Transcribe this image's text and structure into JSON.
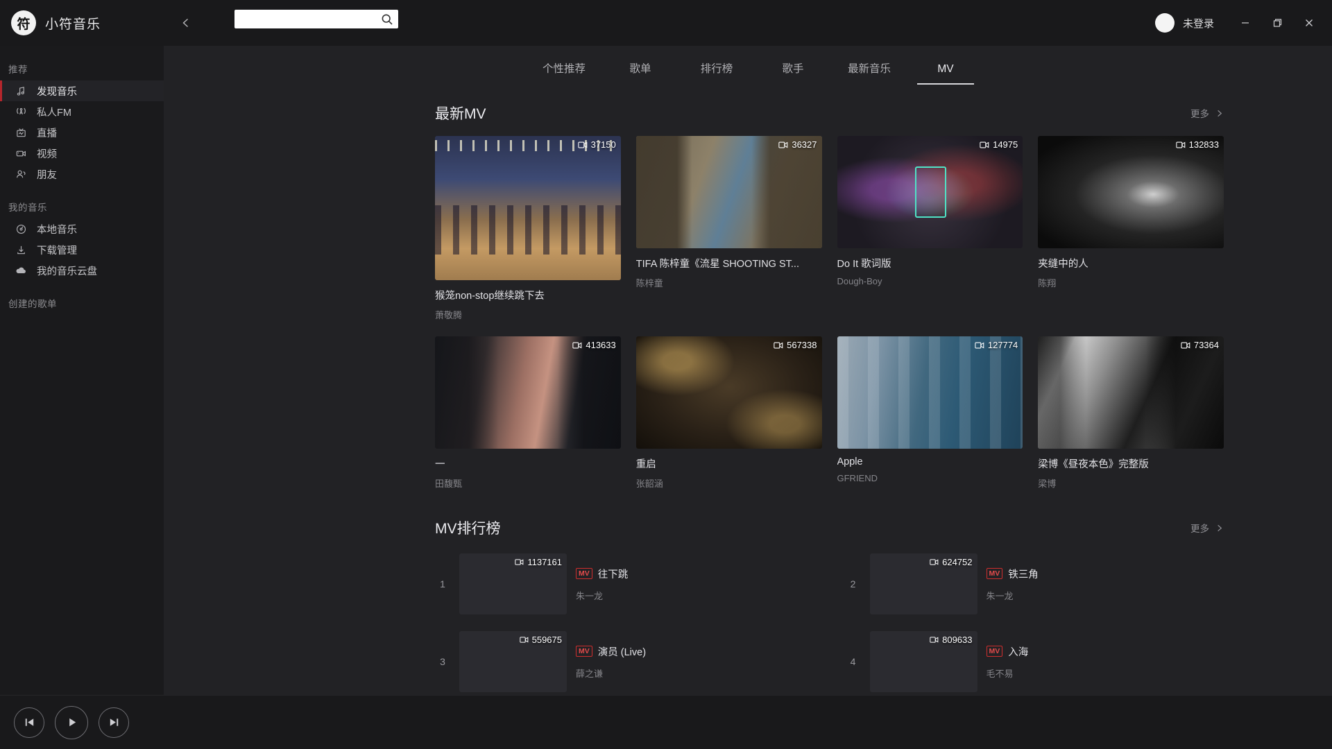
{
  "titlebar": {
    "logo_glyph": "符",
    "brand_name": "小符音乐",
    "back_icon": "chevron-left-icon",
    "search_placeholder": "",
    "search_value": "",
    "search_icon": "search-icon",
    "login_text": "未登录",
    "minimize": "—",
    "maximize": "❐",
    "close": "✕"
  },
  "sidebar": {
    "groups": [
      {
        "title": "推荐",
        "items": [
          {
            "label": "发现音乐",
            "icon": "music-note-icon",
            "active": true
          },
          {
            "label": "私人FM",
            "icon": "radio-icon",
            "active": false
          },
          {
            "label": "直播",
            "icon": "live-tv-icon",
            "active": false
          },
          {
            "label": "视频",
            "icon": "video-camera-icon",
            "active": false
          },
          {
            "label": "朋友",
            "icon": "friends-icon",
            "active": false
          }
        ]
      },
      {
        "title": "我的音乐",
        "items": [
          {
            "label": "本地音乐",
            "icon": "disc-icon",
            "active": false
          },
          {
            "label": "下载管理",
            "icon": "download-icon",
            "active": false
          },
          {
            "label": "我的音乐云盘",
            "icon": "cloud-icon",
            "active": false
          }
        ]
      },
      {
        "title": "创建的歌单",
        "items": []
      }
    ]
  },
  "nav": {
    "tabs": [
      {
        "label": "个性推荐",
        "active": false
      },
      {
        "label": "歌单",
        "active": false
      },
      {
        "label": "排行榜",
        "active": false
      },
      {
        "label": "歌手",
        "active": false
      },
      {
        "label": "最新音乐",
        "active": false
      },
      {
        "label": "MV",
        "active": true
      }
    ]
  },
  "latest_mv": {
    "section_title": "最新MV",
    "more_label": "更多",
    "more_icon": "chevron-right-icon",
    "cards": [
      {
        "title": "猴笼non-stop继续跳下去",
        "artist": "萧敬腾",
        "plays": "37150",
        "art": "dance-stage",
        "tall": true
      },
      {
        "title": "TIFA 陈梓童《流星 SHOOTING ST...",
        "artist": "陈梓童",
        "plays": "36327",
        "art": "ruins"
      },
      {
        "title": "Do It 歌词版",
        "artist": "Dough-Boy",
        "plays": "14975",
        "art": "neon"
      },
      {
        "title": "夹缝中的人",
        "artist": "陈翔",
        "plays": "132833",
        "art": "tunnel"
      },
      {
        "title": "一",
        "artist": "田馥甄",
        "plays": "413633",
        "art": "portrait"
      },
      {
        "title": "重启",
        "artist": "张韶涵",
        "plays": "567338",
        "art": "gold-calligraphy"
      },
      {
        "title": "Apple",
        "artist": "GFRIEND",
        "plays": "127774",
        "art": "group-blue"
      },
      {
        "title": "梁博《昼夜本色》完整版",
        "artist": "梁博",
        "plays": "73364",
        "art": "studio-bw"
      }
    ]
  },
  "mv_rank": {
    "section_title": "MV排行榜",
    "more_label": "更多",
    "more_icon": "chevron-right-icon",
    "badge_label": "MV",
    "rows": [
      {
        "rank": "1",
        "title": "往下跳",
        "artist": "朱一龙",
        "plays": "1137161",
        "art": "night-city"
      },
      {
        "rank": "2",
        "title": "铁三角",
        "artist": "朱一龙",
        "plays": "624752",
        "art": "ink-poster"
      },
      {
        "rank": "3",
        "title": "演员 (Live)",
        "artist": "薛之谦",
        "plays": "559675",
        "art": "stage-live"
      },
      {
        "rank": "4",
        "title": "入海",
        "artist": "毛不易",
        "plays": "809633",
        "art": "ruhai"
      }
    ]
  },
  "player": {
    "prev_icon": "skip-previous-icon",
    "play_icon": "play-icon",
    "next_icon": "skip-next-icon"
  },
  "colors": {
    "accent": "#b5262c",
    "badge": "#d02e2e",
    "bg": "#222225",
    "sidebar_bg": "#1a1a1c",
    "titlebar_bg": "#19191b"
  }
}
